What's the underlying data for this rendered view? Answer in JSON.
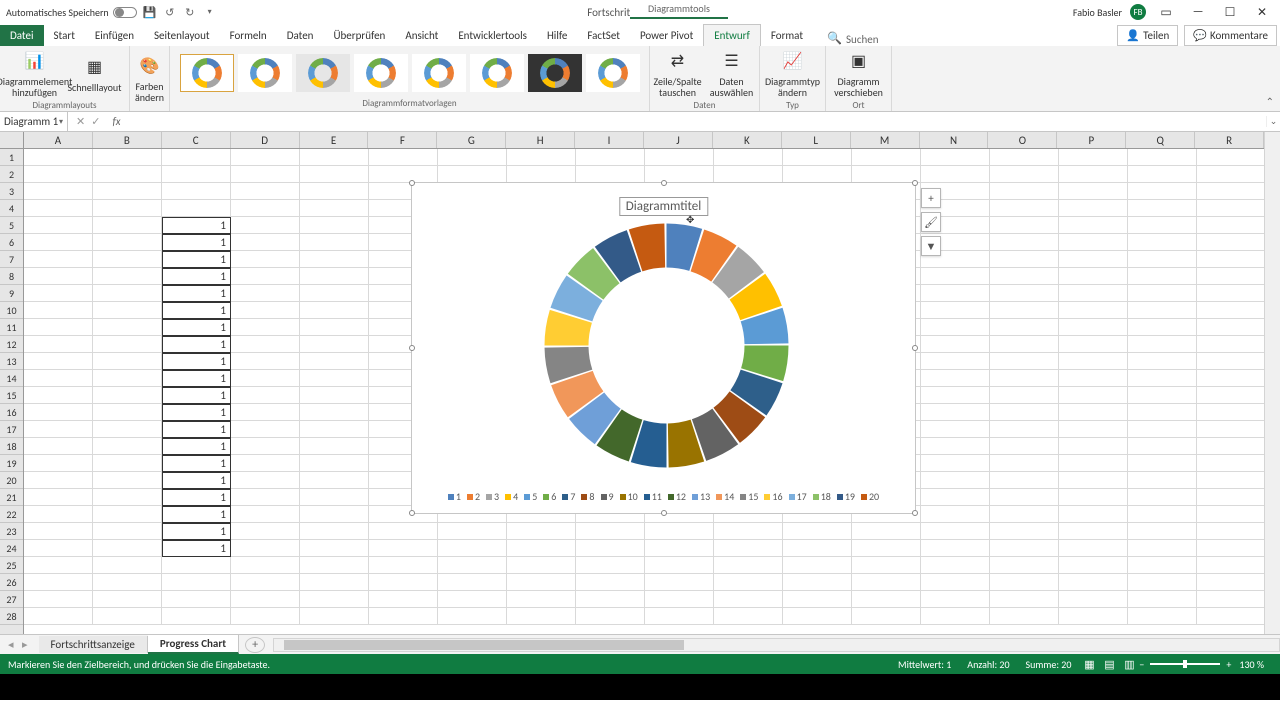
{
  "title_bar": {
    "autosave_label": "Automatisches Speichern",
    "doc_title": "Fortschrittsanzeige  -  Excel",
    "tool_context": "Diagrammtools",
    "user_name": "Fabio Basler",
    "user_initials": "FB"
  },
  "ribbon_tabs": {
    "file": "Datei",
    "tabs": [
      "Start",
      "Einfügen",
      "Seitenlayout",
      "Formeln",
      "Daten",
      "Überprüfen",
      "Ansicht",
      "Entwicklertools",
      "Hilfe",
      "FactSet",
      "Power Pivot",
      "Entwurf",
      "Format"
    ],
    "active": "Entwurf",
    "search": "Suchen",
    "share": "Teilen",
    "comments": "Kommentare"
  },
  "ribbon": {
    "add_element": "Diagrammelement hinzufügen",
    "quick_layout": "Schnelllayout",
    "change_colors": "Farben ändern",
    "group_layouts": "Diagrammlayouts",
    "group_styles": "Diagrammformatvorlagen",
    "switch_rc": "Zeile/Spalte tauschen",
    "select_data": "Daten auswählen",
    "group_data": "Daten",
    "change_type": "Diagrammtyp ändern",
    "group_type": "Typ",
    "move_chart": "Diagramm verschieben",
    "group_location": "Ort"
  },
  "name_box": "Diagramm 1",
  "columns": [
    "A",
    "B",
    "C",
    "D",
    "E",
    "F",
    "G",
    "H",
    "I",
    "J",
    "K",
    "L",
    "M",
    "N",
    "O",
    "P",
    "Q",
    "R"
  ],
  "rows": [
    1,
    2,
    3,
    4,
    5,
    6,
    7,
    8,
    9,
    10,
    11,
    12,
    13,
    14,
    15,
    16,
    17,
    18,
    19,
    20,
    21,
    22,
    23,
    24,
    25,
    26,
    27,
    28
  ],
  "c_data": [
    1,
    1,
    1,
    1,
    1,
    1,
    1,
    1,
    1,
    1,
    1,
    1,
    1,
    1,
    1,
    1,
    1,
    1,
    1,
    1
  ],
  "chart_data": {
    "type": "doughnut",
    "title": "Diagrammtitel",
    "categories": [
      1,
      2,
      3,
      4,
      5,
      6,
      7,
      8,
      9,
      10,
      11,
      12,
      13,
      14,
      15,
      16,
      17,
      18,
      19,
      20
    ],
    "values": [
      1,
      1,
      1,
      1,
      1,
      1,
      1,
      1,
      1,
      1,
      1,
      1,
      1,
      1,
      1,
      1,
      1,
      1,
      1,
      1
    ],
    "colors": [
      "#4f81bd",
      "#ed7d31",
      "#a5a5a5",
      "#ffc000",
      "#5b9bd5",
      "#70ad47",
      "#2e5f8a",
      "#9e4c15",
      "#636363",
      "#997300",
      "#255e91",
      "#43682b",
      "#6f9fd8",
      "#f1975a",
      "#858585",
      "#ffcd33",
      "#7cafdd",
      "#8cc168",
      "#335a88",
      "#c55a11"
    ]
  },
  "sheet_tabs": {
    "tab1": "Fortschrittsanzeige",
    "tab2": "Progress Chart"
  },
  "status_bar": {
    "msg": "Markieren Sie den Zielbereich, und drücken Sie die Eingabetaste.",
    "avg": "Mittelwert: 1",
    "count": "Anzahl: 20",
    "sum": "Summe: 20",
    "zoom": "130 %"
  }
}
